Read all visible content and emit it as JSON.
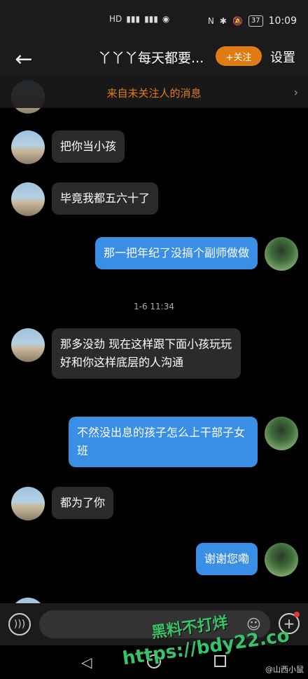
{
  "status_bar": {
    "left_icons": [
      "HD",
      "4G",
      "signal",
      "4G",
      "signal",
      "wechat"
    ],
    "time": "10:09",
    "battery": "37"
  },
  "header": {
    "title": "丫丫丫每天都要...",
    "follow_label": "+关注",
    "settings_label": "设置"
  },
  "notice": {
    "text": "来自未关注人的消息",
    "color": "#e07a12"
  },
  "messages": [
    {
      "side": "left",
      "text": "把你当小孩"
    },
    {
      "side": "left",
      "text": "毕竟我都五六十了"
    },
    {
      "side": "right",
      "text": "那一把年纪了没搞个副师做做"
    },
    {
      "side": "left",
      "text": "那多没劲 现在这样跟下面小孩玩玩 好和你这样底层的人沟通"
    },
    {
      "side": "right",
      "text": "不然没出息的孩子怎么上干部子女班"
    },
    {
      "side": "left",
      "text": "都为了你"
    },
    {
      "side": "right",
      "text": "谢谢您嘞"
    }
  ],
  "timestamp": "1-6 11:34",
  "input": {
    "placeholder": ""
  },
  "watermark": {
    "line1": "黑料不打烊",
    "line2": "https://bdy22.co"
  },
  "weibo_credit": "@山西小鼠"
}
